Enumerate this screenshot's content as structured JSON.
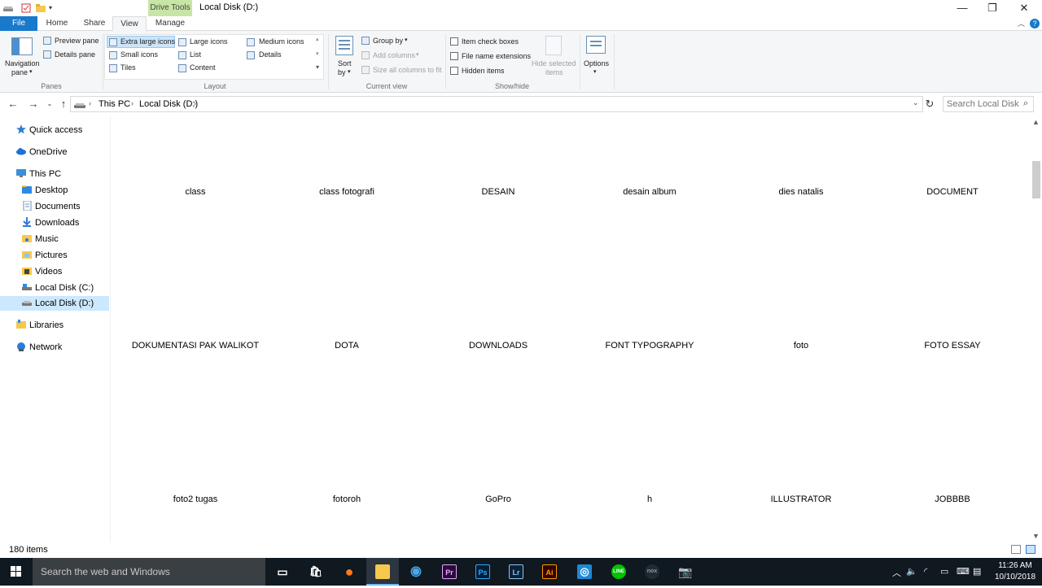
{
  "window": {
    "title": "Local Disk (D:)",
    "context_tab": "Drive Tools",
    "minimize_glyph": "—",
    "restore_glyph": "❐",
    "close_glyph": "✕"
  },
  "tabs": [
    {
      "label": "File"
    },
    {
      "label": "Home"
    },
    {
      "label": "Share"
    },
    {
      "label": "View"
    },
    {
      "label": "Manage"
    }
  ],
  "ribbon": {
    "panes": {
      "navigation_pane": "Navigation",
      "navigation_pane_2": "pane",
      "preview_pane": "Preview pane",
      "details_pane": "Details pane",
      "group_label": "Panes"
    },
    "layout": {
      "items": [
        "Extra large icons",
        "Large icons",
        "Medium icons",
        "Small icons",
        "List",
        "Details",
        "Tiles",
        "Content"
      ],
      "selected": "Extra large icons",
      "group_label": "Layout"
    },
    "current_view": {
      "sort_by": "Sort",
      "sort_by_2": "by",
      "group_by": "Group by",
      "add_columns": "Add columns",
      "size_columns": "Size all columns to fit",
      "group_label": "Current view"
    },
    "show_hide": {
      "item_check_boxes": "Item check boxes",
      "file_name_extensions": "File name extensions",
      "hidden_items": "Hidden items",
      "hide_selected": "Hide selected",
      "hide_selected_2": "items",
      "group_label": "Show/hide"
    },
    "options": {
      "label": "Options"
    }
  },
  "address": {
    "crumbs": [
      "This PC",
      "Local Disk (D:)"
    ],
    "search_placeholder": "Search Local Disk ..."
  },
  "nav_pane": {
    "items": [
      {
        "label": "Quick access",
        "icon": "star-icon"
      },
      {
        "label": "OneDrive",
        "icon": "cloud-icon"
      },
      {
        "label": "This PC",
        "icon": "computer-icon"
      },
      {
        "label": "Desktop",
        "icon": "folder-icon"
      },
      {
        "label": "Documents",
        "icon": "folder-icon"
      },
      {
        "label": "Downloads",
        "icon": "folder-icon"
      },
      {
        "label": "Music",
        "icon": "folder-icon"
      },
      {
        "label": "Pictures",
        "icon": "folder-icon"
      },
      {
        "label": "Videos",
        "icon": "folder-icon"
      },
      {
        "label": "Local Disk (C:)",
        "icon": "drive-icon"
      },
      {
        "label": "Local Disk (D:)",
        "icon": "drive-icon",
        "selected": true
      },
      {
        "label": "Libraries",
        "icon": "library-icon"
      },
      {
        "label": "Network",
        "icon": "network-icon"
      }
    ]
  },
  "files": [
    "class",
    "class fotografi",
    "DESAIN",
    "desain album",
    "dies natalis",
    "DOCUMENT",
    "DOKUMENTASI PAK WALIKOT",
    "DOTA",
    "DOWNLOADS",
    "FONT TYPOGRAPHY",
    "foto",
    "FOTO ESSAY",
    "foto2 tugas",
    "fotoroh",
    "GoPro",
    "h",
    "ILLUSTRATOR",
    "JOBBBB"
  ],
  "status": {
    "item_count": "180 items"
  },
  "taskbar": {
    "search_text": "Search the web and Windows",
    "apps": [
      {
        "name": "task-view",
        "glyph": "▭",
        "color": "#ffffff",
        "bg": "transparent"
      },
      {
        "name": "store",
        "glyph": "🛍",
        "color": "#ffffff",
        "bg": "transparent"
      },
      {
        "name": "firefox",
        "glyph": "●",
        "color": "#ff7a1a",
        "bg": "transparent"
      },
      {
        "name": "file-explorer",
        "glyph": "",
        "color": "#f6c94c",
        "bg": "#f6c94c"
      },
      {
        "name": "browser-globe",
        "glyph": "◉",
        "color": "#4aa8e8",
        "bg": "transparent"
      },
      {
        "name": "premiere",
        "glyph": "Pr",
        "color": "#e8a6ff",
        "bg": "#2a0a3a"
      },
      {
        "name": "photoshop",
        "glyph": "Ps",
        "color": "#31a8ff",
        "bg": "#001e36"
      },
      {
        "name": "lightroom",
        "glyph": "Lr",
        "color": "#8fc3e8",
        "bg": "#0a2238"
      },
      {
        "name": "illustrator",
        "glyph": "Ai",
        "color": "#ff9a00",
        "bg": "#330000"
      },
      {
        "name": "instagram",
        "glyph": "◎",
        "color": "#ffffff",
        "bg": "#1e88d6"
      },
      {
        "name": "line",
        "glyph": "LINE",
        "color": "#ffffff",
        "bg": "#00c300"
      },
      {
        "name": "app-nox",
        "glyph": "nox",
        "color": "#8a9aa8",
        "bg": "#1f2a33"
      },
      {
        "name": "camera",
        "glyph": "📷",
        "color": "#ffffff",
        "bg": "transparent"
      }
    ],
    "time": "11:26 AM",
    "date": "10/10/2018"
  }
}
